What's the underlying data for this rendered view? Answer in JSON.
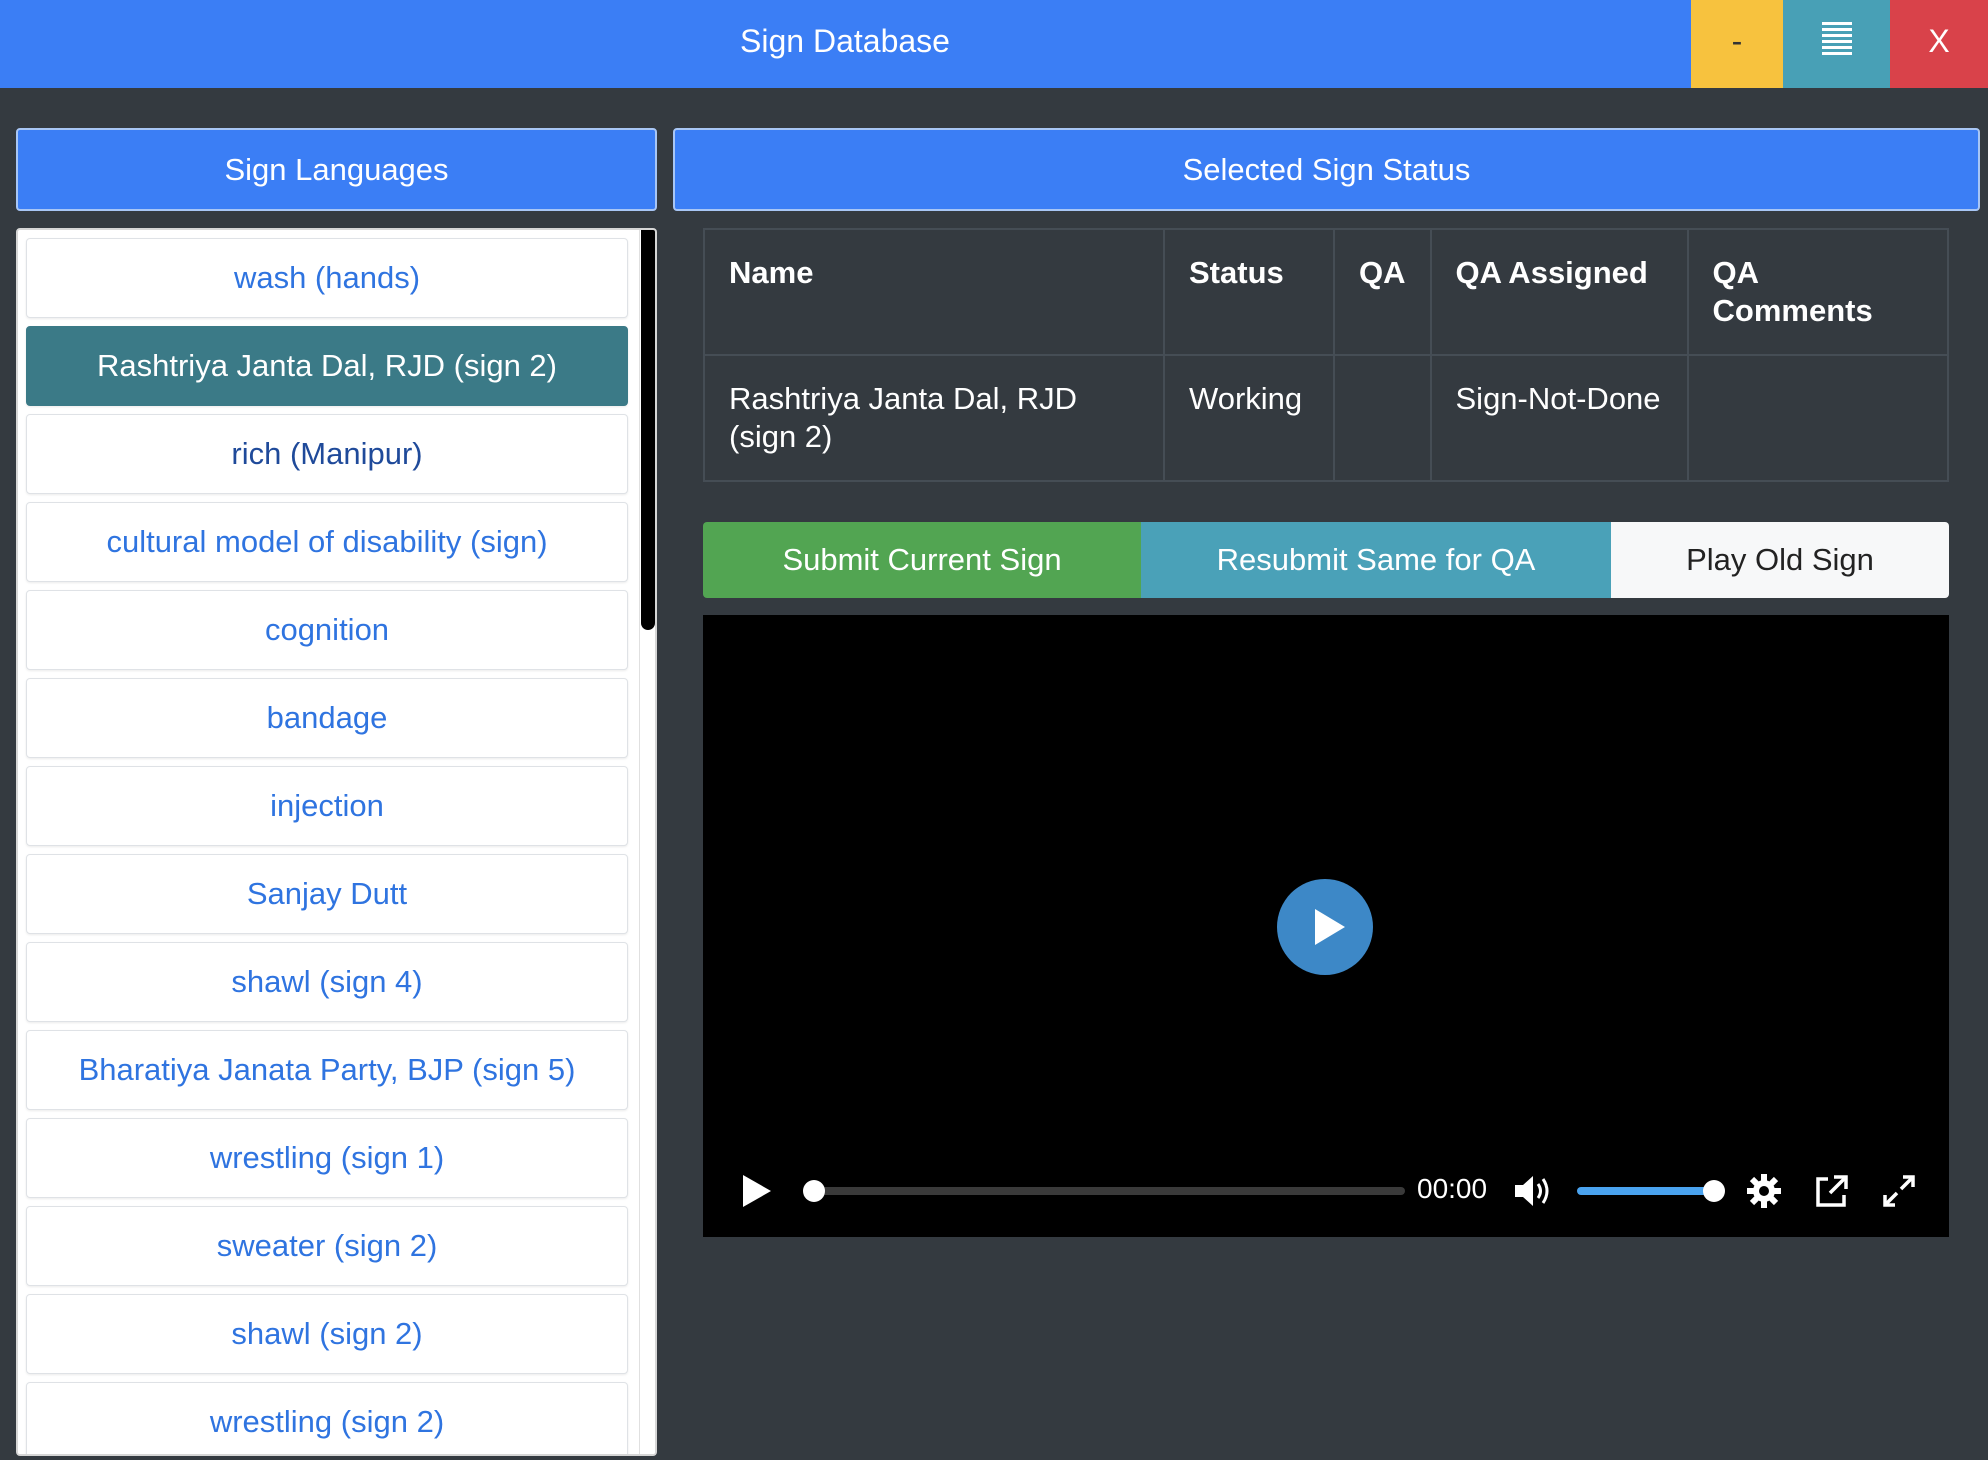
{
  "window": {
    "title": "Sign Database",
    "minimize_label": "-",
    "close_label": "X"
  },
  "left_panel": {
    "header": "Sign Languages",
    "items": [
      {
        "label": "wash (hands)"
      },
      {
        "label": "Rashtriya Janta Dal, RJD (sign 2)",
        "selected": true
      },
      {
        "label": "rich (Manipur)"
      },
      {
        "label": "cultural model of disability (sign)"
      },
      {
        "label": "cognition"
      },
      {
        "label": "bandage"
      },
      {
        "label": "injection"
      },
      {
        "label": "Sanjay Dutt"
      },
      {
        "label": "shawl (sign 4)"
      },
      {
        "label": "Bharatiya Janata Party, BJP (sign 5)"
      },
      {
        "label": "wrestling (sign 1)"
      },
      {
        "label": "sweater (sign 2)"
      },
      {
        "label": "shawl (sign 2)"
      },
      {
        "label": "wrestling (sign 2)"
      }
    ]
  },
  "right_panel": {
    "header": "Selected Sign Status",
    "table": {
      "headers": [
        "Name",
        "Status",
        "QA",
        "QA Assigned",
        "QA Comments"
      ],
      "row": [
        "Rashtriya Janta Dal, RJD (sign 2)",
        "Working",
        "",
        "Sign-Not-Done",
        ""
      ]
    },
    "actions": {
      "submit": "Submit Current Sign",
      "resubmit": "Resubmit Same for QA",
      "play_old": "Play Old Sign"
    },
    "video": {
      "time": "00:00",
      "progress": 0,
      "volume": 1.0
    }
  },
  "colors": {
    "primary": "#3b7ef5",
    "selected_item": "#3b7a87",
    "success": "#52a552",
    "info": "#4aa1b8",
    "warning": "#f7c23e",
    "danger": "#d9424a",
    "background": "#343a40"
  }
}
